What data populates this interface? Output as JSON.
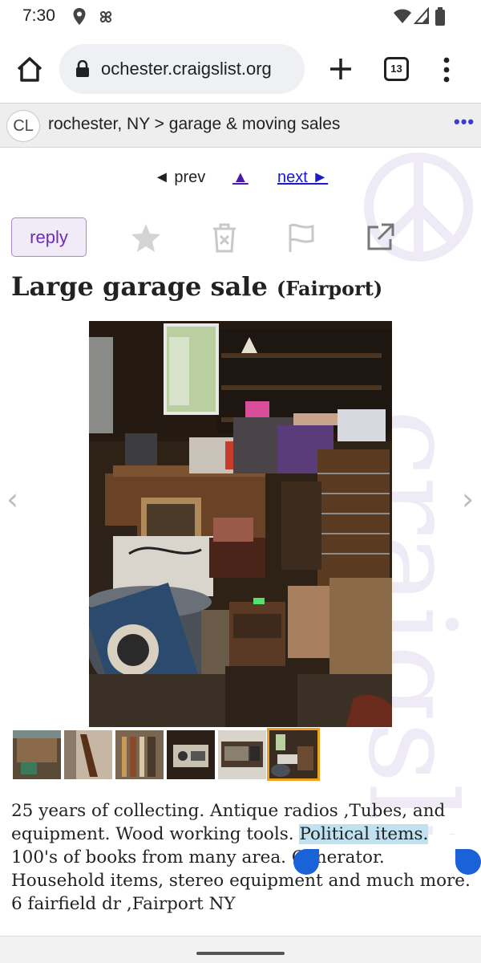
{
  "status_bar": {
    "time": "7:30",
    "icons": [
      "location-icon",
      "pinwheel-icon",
      "wifi-icon",
      "signal-icon",
      "battery-icon"
    ]
  },
  "browser": {
    "url": "ochester.craigslist.org",
    "tab_count": "13",
    "icons": [
      "home-icon",
      "lock-icon",
      "plus-icon",
      "tabs-icon",
      "kebab-menu-icon"
    ]
  },
  "site_header": {
    "logo": "CL",
    "breadcrumb": "rochester, NY > garage & moving sales",
    "more": "•••"
  },
  "watermark": "craigslist",
  "pager": {
    "prev": "◄ prev",
    "up": "▲",
    "next": "next ►"
  },
  "actions": {
    "reply_label": "reply",
    "icons": [
      "star-icon",
      "trash-icon",
      "flag-icon",
      "share-icon"
    ]
  },
  "post": {
    "title": "Large garage sale",
    "location": "(Fairport)",
    "body_before": "25 years of collecting. Antique radios ,Tubes, and equipment. Wood working tools. ",
    "body_highlight": "Political items.",
    "body_after": " 100's of books from many area. Generator. Household items, stereo equipment and much more. 6 fairfield dr ,Fairport NY"
  },
  "gallery": {
    "thumb_count": 6,
    "active_index": 5,
    "nav_prev": "‹",
    "nav_next": "›"
  },
  "colors": {
    "link": "#1a1ac8",
    "visited": "#4b1ba8",
    "reply_accent": "#6b2fb0",
    "selection_highlight": "#bfe1f0",
    "selection_handle": "#1a62d8",
    "active_thumb": "#f0a020"
  }
}
